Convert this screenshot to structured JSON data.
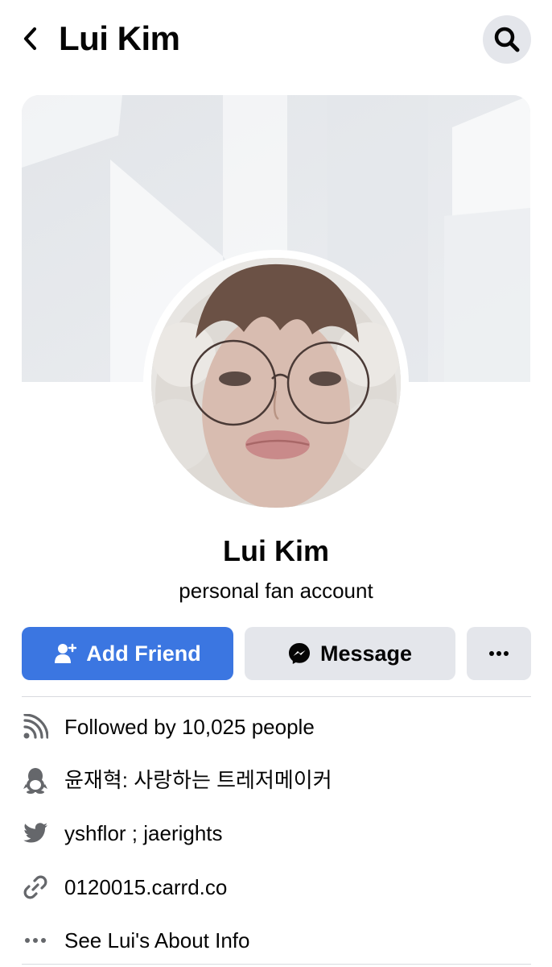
{
  "header": {
    "title": "Lui Kim"
  },
  "profile": {
    "name": "Lui Kim",
    "bio": "personal fan account"
  },
  "actions": {
    "add_friend": "Add Friend",
    "message": "Message"
  },
  "info": [
    {
      "icon": "rss-icon",
      "text": "Followed by 10,025 people"
    },
    {
      "icon": "qq-penguin-icon",
      "text": "윤재혁: 사랑하는 트레저메이커"
    },
    {
      "icon": "twitter-icon",
      "text": "yshflor ; jaerights"
    },
    {
      "icon": "link-icon",
      "text": "0120015.carrd.co"
    },
    {
      "icon": "more-dots-icon",
      "text": "See Lui's About Info"
    }
  ],
  "colors": {
    "primary": "#3b76e1",
    "secondary_button": "#e4e6eb",
    "icon_gray": "#65676b"
  }
}
